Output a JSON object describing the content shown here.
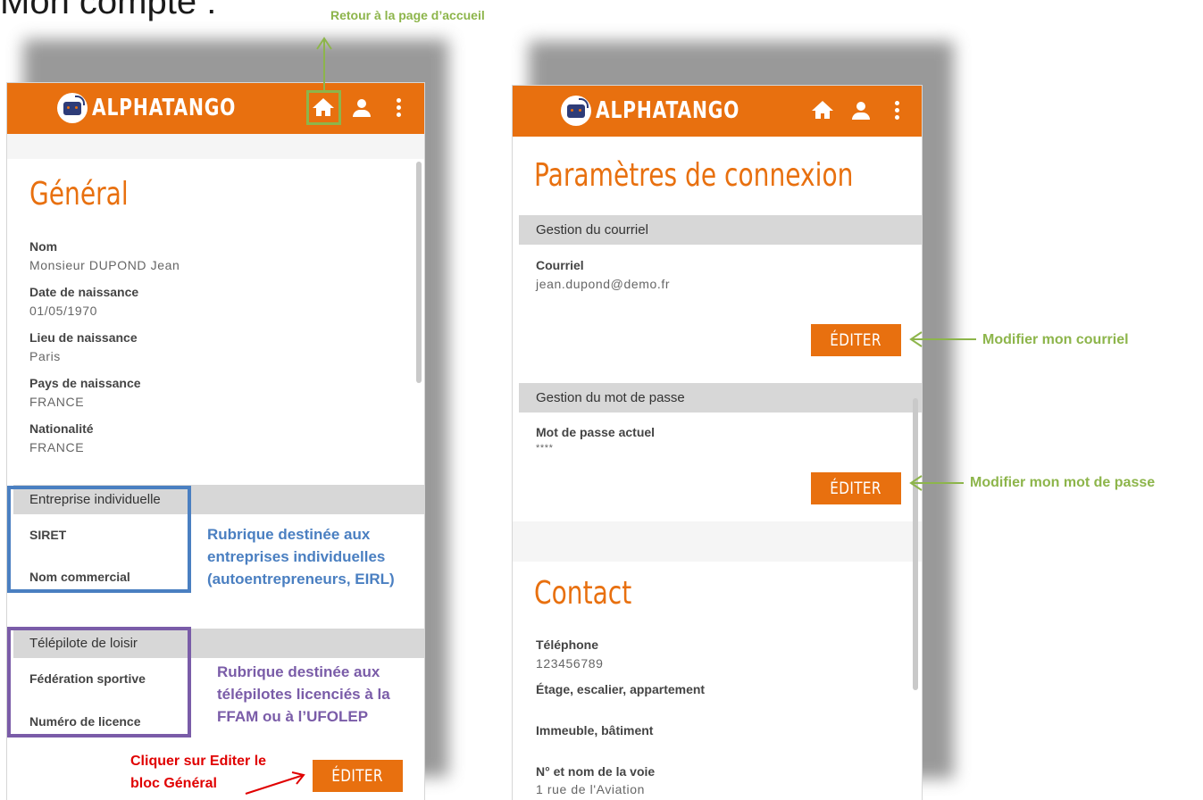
{
  "page": {
    "title": "Mon compte :"
  },
  "app": {
    "brand": "ALPHATANGO"
  },
  "left_panel": {
    "heading": "Général",
    "fields": [
      {
        "label": "Nom",
        "value": "Monsieur DUPOND Jean"
      },
      {
        "label": "Date de naissance",
        "value": "01/05/1970"
      },
      {
        "label": "Lieu de naissance",
        "value": "Paris"
      },
      {
        "label": "Pays de naissance",
        "value": "FRANCE"
      },
      {
        "label": "Nationalité",
        "value": "FRANCE"
      }
    ],
    "section_entreprise": {
      "title": "Entreprise individuelle",
      "fields": [
        "SIRET",
        "Nom commercial"
      ]
    },
    "section_telepilote": {
      "title": "Télépilote de loisir",
      "fields": [
        "Fédération sportive",
        "Numéro de licence"
      ]
    },
    "edit_label": "ÉDITER"
  },
  "right_panel": {
    "heading": "Paramètres de connexion",
    "courriel": {
      "section": "Gestion du courriel",
      "label": "Courriel",
      "value": "jean.dupond@demo.fr",
      "edit_label": "ÉDITER"
    },
    "password": {
      "section": "Gestion du mot de passe",
      "label": "Mot de passe actuel",
      "value": "****",
      "edit_label": "ÉDITER"
    },
    "contact": {
      "heading": "Contact",
      "fields": [
        {
          "label": "Téléphone",
          "value": "123456789"
        },
        {
          "label": "Étage, escalier, appartement",
          "value": ""
        },
        {
          "label": "Immeuble, bâtiment",
          "value": ""
        },
        {
          "label": "N° et nom de la voie",
          "value": "1 rue de l'Aviation"
        }
      ]
    }
  },
  "annotations": {
    "home": "Retour à la page d’accueil",
    "entreprise": [
      "Rubrique destinée aux",
      "entreprises individuelles",
      "(autoentrepreneurs, EIRL)"
    ],
    "telepilote": [
      "Rubrique destinée aux",
      "télépilotes licenciés à la",
      "FFAM ou à l’UFOLEP"
    ],
    "edit": [
      "Cliquer sur Editer le",
      "bloc Général"
    ],
    "courriel": "Modifier mon courriel",
    "password": "Modifier mon mot de passe"
  },
  "colors": {
    "brand_orange": "#e8700f",
    "annotation_green": "#8db54b",
    "annotation_blue": "#4a7fc1",
    "annotation_purple": "#7a5ca8",
    "annotation_red": "#e00000"
  }
}
